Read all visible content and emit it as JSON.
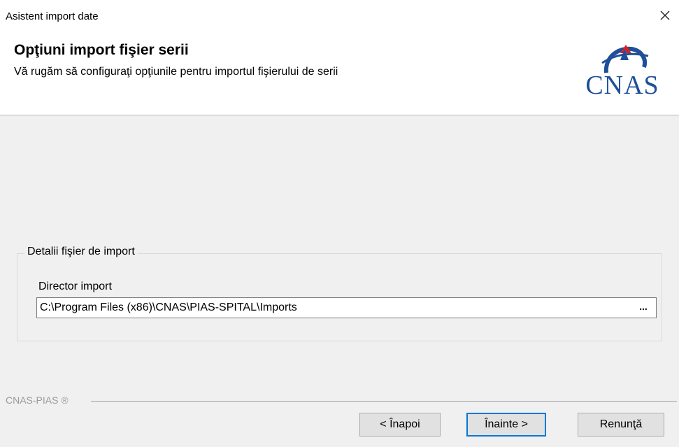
{
  "window": {
    "title": "Asistent import date",
    "close_icon": "close-icon"
  },
  "header": {
    "heading": "Opţiuni import fişier serii",
    "subheading": "Vă rugăm să configuraţi opţiunile pentru importul fişierului de serii",
    "logo_text": "CNAS",
    "logo_colors": {
      "primary": "#1f4f99",
      "accent": "#d2232a"
    }
  },
  "group": {
    "legend": "Detalii fişier de import",
    "field_label": "Director import",
    "path_value": "C:\\Program Files (x86)\\CNAS\\PIAS-SPITAL\\Imports",
    "browse_label": "..."
  },
  "footer": {
    "brand": "CNAS-PIAS ®"
  },
  "buttons": {
    "back": "< Înapoi",
    "next": "Înainte >",
    "cancel": "Renunţă"
  }
}
